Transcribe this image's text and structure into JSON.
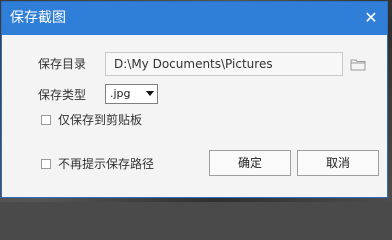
{
  "dialog": {
    "title": "保存截图",
    "close_glyph": "✕",
    "save_dir_label": "保存目录",
    "save_dir_value": "D:\\My Documents\\Pictures",
    "save_type_label": "保存类型",
    "save_type_selected": ".jpg",
    "clipboard_only_label": "仅保存到剪贴板",
    "no_prompt_label": "不再提示保存路径",
    "ok_label": "确定",
    "cancel_label": "取消"
  },
  "icons": {
    "close": "close-icon",
    "folder": "folder-icon",
    "dropdown": "chevron-down-icon"
  },
  "colors": {
    "titlebar": "#2f7ed8",
    "dialog_bg": "#f4f4f4",
    "text": "#333333"
  }
}
